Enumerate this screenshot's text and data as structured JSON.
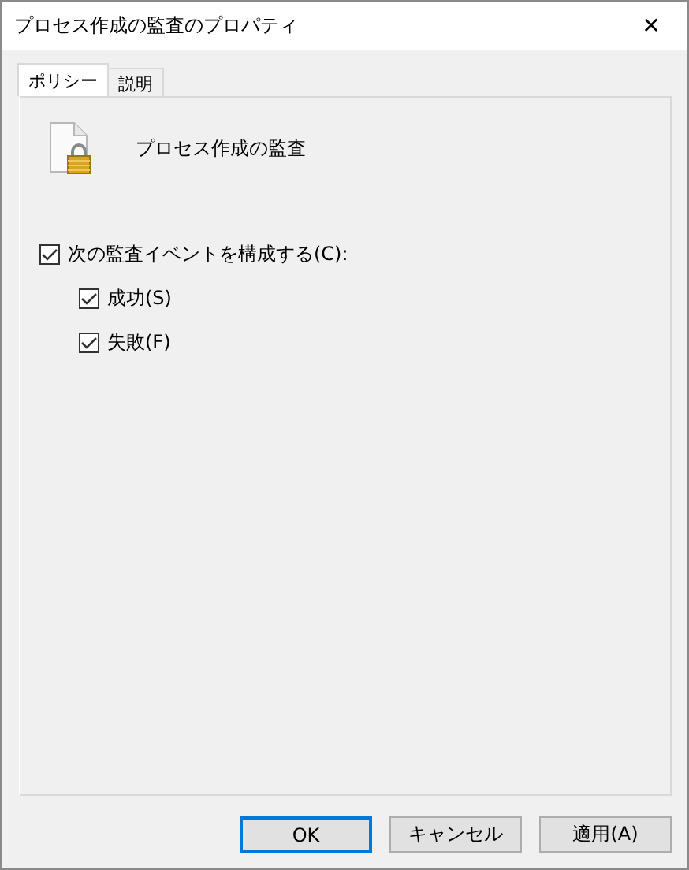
{
  "window": {
    "title": "プロセス作成の監査のプロパティ",
    "close": "✕"
  },
  "tabs": [
    {
      "label": "ポリシー",
      "selected": true
    },
    {
      "label": "説明",
      "selected": false
    }
  ],
  "policy": {
    "name": "プロセス作成の監査"
  },
  "options": [
    {
      "label": "次の監査イベントを構成する(C):",
      "checked": true,
      "children": [
        {
          "label": "成功(S)",
          "checked": true
        },
        {
          "label": "失敗(F)",
          "checked": true
        }
      ]
    }
  ],
  "buttons": [
    {
      "label": "OK",
      "default": true
    },
    {
      "label": "キャンセル",
      "default": false
    },
    {
      "label": "適用(A)",
      "default": false
    }
  ]
}
